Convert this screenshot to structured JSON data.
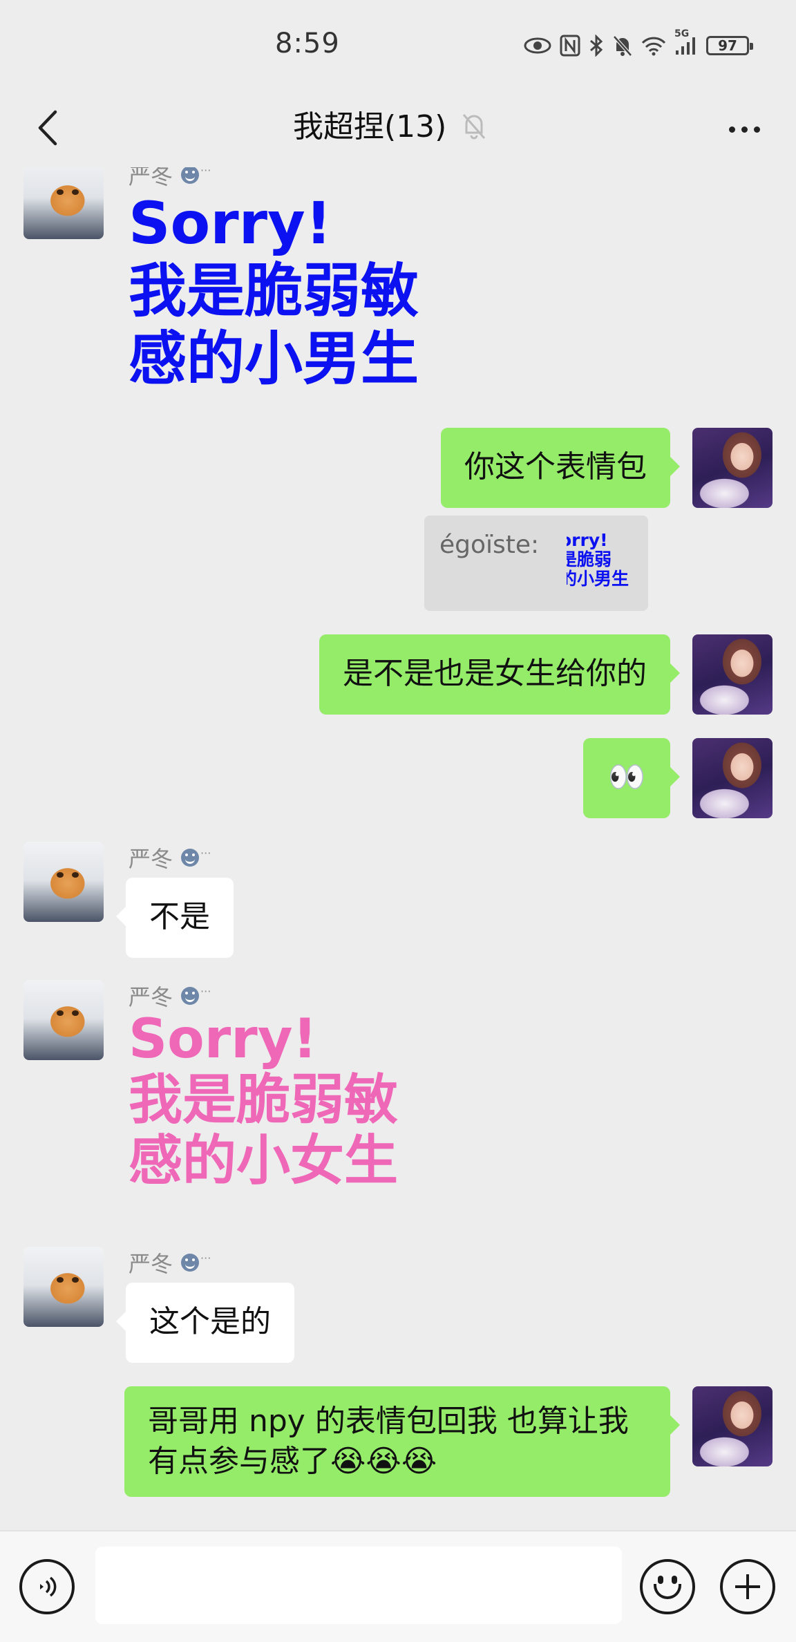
{
  "status_bar": {
    "time": "8:59",
    "network_label": "5G",
    "battery": "97",
    "icons": [
      "eye-icon",
      "nfc-icon",
      "bluetooth-icon",
      "mute-bell-icon",
      "wifi-icon",
      "signal-icon",
      "battery-icon"
    ]
  },
  "header": {
    "title": "我超捏(13)",
    "muted_icon": "bell-off-icon",
    "back_icon": "chevron-left-icon",
    "more_icon": "more-dots-icon"
  },
  "messages": [
    {
      "side": "left",
      "sender": "严冬",
      "type": "sticker",
      "text": "Sorry!\n我是脆弱敏\n感的小男生"
    },
    {
      "side": "right",
      "type": "text",
      "text": "你这个表情包"
    },
    {
      "side": "right",
      "type": "quote",
      "quote_sender": "égoïste:",
      "quote_text": "orry!\n是脆弱\n的小男生"
    },
    {
      "side": "right",
      "type": "text",
      "text": "是不是也是女生给你的"
    },
    {
      "side": "right",
      "type": "text",
      "text": "👀"
    },
    {
      "side": "left",
      "sender": "严冬",
      "type": "text",
      "text": "不是"
    },
    {
      "side": "left",
      "sender": "严冬",
      "type": "sticker",
      "text": "Sorry!\n我是脆弱敏\n感的小女生"
    },
    {
      "side": "left",
      "sender": "严冬",
      "type": "text",
      "text": "这个是的"
    },
    {
      "side": "right",
      "type": "text",
      "text": "哥哥用 npy 的表情包回我 也算让我\n有点参与感了😭😭😭"
    }
  ],
  "input_bar": {
    "placeholder": "",
    "voice_icon": "voice-icon",
    "emoji_icon": "emoji-icon",
    "plus_icon": "plus-icon"
  },
  "colors": {
    "background": "#ededed",
    "right_bubble": "#95ec69",
    "left_bubble": "#ffffff",
    "sticker_blue": "#0b11f0",
    "sticker_pink": "#ef68b8"
  }
}
